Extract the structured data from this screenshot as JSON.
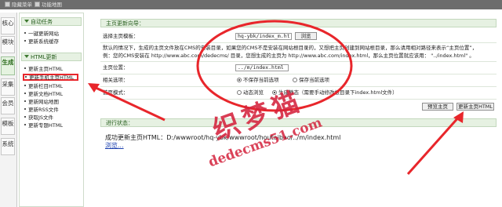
{
  "topbar": {
    "items": [
      {
        "label": "隐藏菜单",
        "icon": "hide-menu-icon"
      },
      {
        "label": "功能地图",
        "icon": "function-map-icon"
      }
    ]
  },
  "vertical_tabs": [
    "核心",
    "模块",
    "生成",
    "采集",
    "会员",
    "模板",
    "系统"
  ],
  "vertical_tabs_active": "生成",
  "sidebar": {
    "sections": [
      {
        "title": "自动任务",
        "items": [
          "一键更新网站",
          "更新系统缓存"
        ]
      },
      {
        "title": "HTML更新",
        "items": [
          "更新主页HTML",
          "更新手机主页HTML",
          "更新栏目HTML",
          "更新文档HTML",
          "更新网站地图",
          "更新RSS文件",
          "获取JS文件",
          "更新专题HTML"
        ]
      }
    ],
    "highlighted_item": "更新手机主页HTML"
  },
  "main": {
    "panel_title": "主页更新向导：",
    "template": {
      "label": "选择主页模板：",
      "value": "hq-ybk/index_m.htm",
      "browse_label": "浏览"
    },
    "info_line1": "默认的情况下，生成的主页文件放在CMS的安装目录，如果您的CMS不是安装在网站根目录的，又想把主页创建到网站根目录，那么请用相对路径来表示“主页位置”，",
    "info_line2": "例：您的CMS安装在 http://www.abc.com/dedecms/ 目录，您想生成的主页为 http://www.abc.com/index.html，那么主页位置就应该用： \"../index.html\" 。",
    "location": {
      "label": "主页位置：",
      "value": "../m/index.html"
    },
    "options": {
      "label": "相关选项：",
      "radio1": "不保存当前选项",
      "radio2": "保存当前选项"
    },
    "mode": {
      "label": "首页模式：",
      "radio1": "动态浏览",
      "radio2": "生成静态（需要手动修改根目录下index.html文件）"
    },
    "buttons": {
      "preview": "预览主页",
      "update": "更新主页HTML"
    },
    "progress": {
      "label": "进行状态：",
      "message": "成功更新主页HTML：D:/wwwroot/hq-ybk/wwwroot/houtaibao/../m/index.html",
      "browse_link": "浏览..."
    }
  },
  "watermark": {
    "main_text": "织梦猫",
    "url_text": "dedecms51.com",
    "color": "#d4233d"
  },
  "colors": {
    "annotation_red": "#e8262b",
    "topbar": "#6d6d6d",
    "section_header": "#e6f1e2"
  }
}
